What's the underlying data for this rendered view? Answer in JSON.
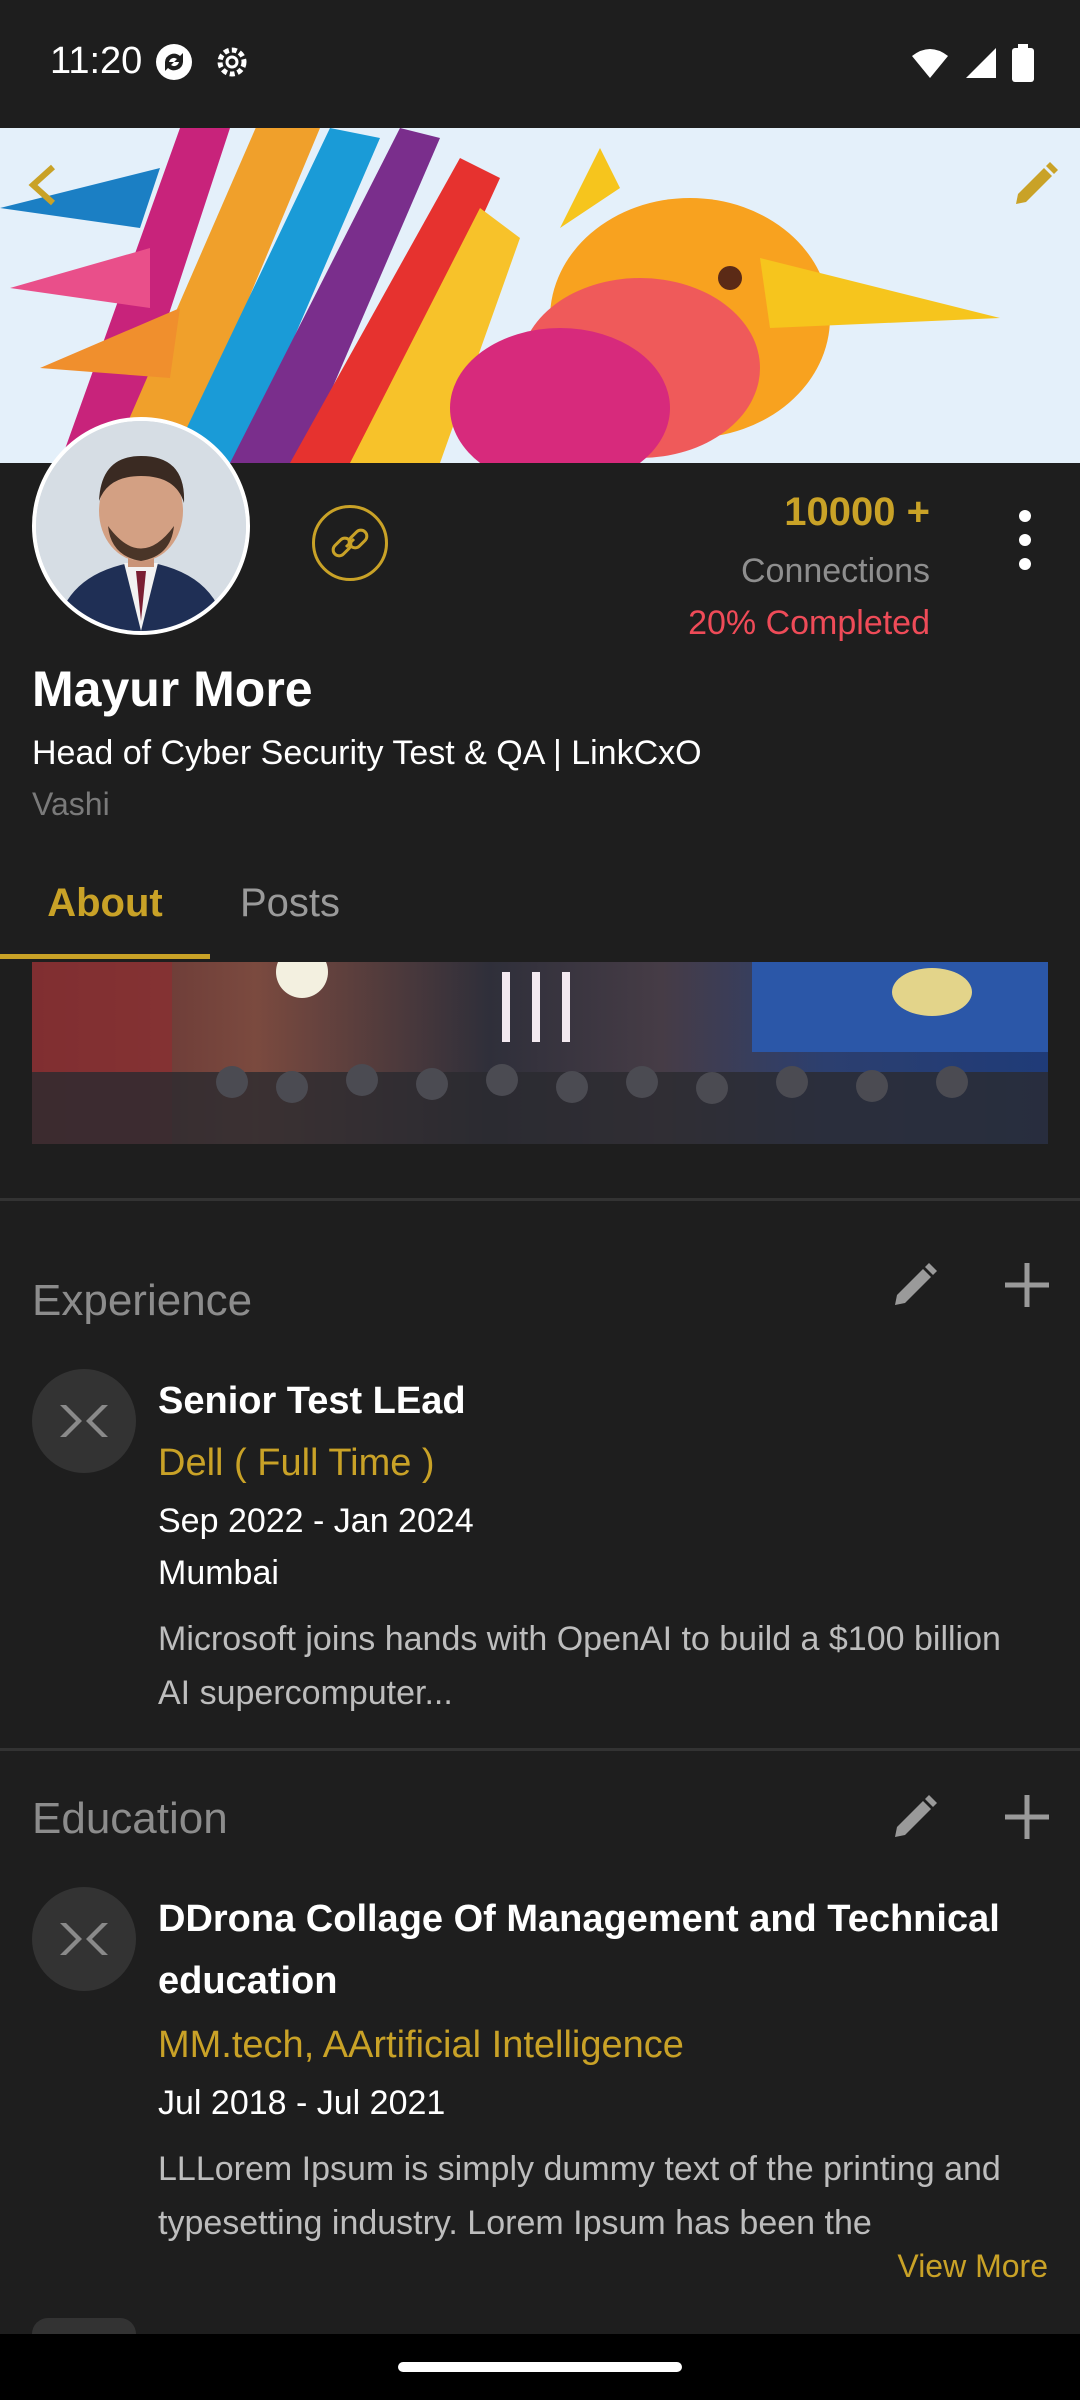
{
  "status_bar": {
    "time": "11:20"
  },
  "profile": {
    "connections_count": "10000 +",
    "connections_label": "Connections",
    "completion": "20%  Completed",
    "name": "Mayur More",
    "headline": "Head of Cyber Security Test & QA | LinkCxO",
    "location": "Vashi"
  },
  "tabs": [
    {
      "label": "About"
    },
    {
      "label": "Posts"
    }
  ],
  "experience": {
    "title": "Experience",
    "items": [
      {
        "title": "Senior Test LEad",
        "company": "Dell ( Full Time )",
        "dates": "Sep 2022 - Jan 2024",
        "location": "Mumbai",
        "description": "Microsoft joins hands with OpenAI to build a $100 billion AI supercomputer..."
      }
    ]
  },
  "education": {
    "title": "Education",
    "items": [
      {
        "title": "DDrona Collage Of Management and Technical education",
        "degree": "MM.tech, AArtificial Intelligence",
        "dates": "Jul 2018 - Jul 2021",
        "description": "LLLorem Ipsum is simply dummy text of the printing and typesetting industry. Lorem Ipsum has been the",
        "view_more": "View More"
      }
    ]
  },
  "colors": {
    "accent": "#c9a227",
    "background": "#1e1e1e",
    "danger": "#ef4b58"
  }
}
